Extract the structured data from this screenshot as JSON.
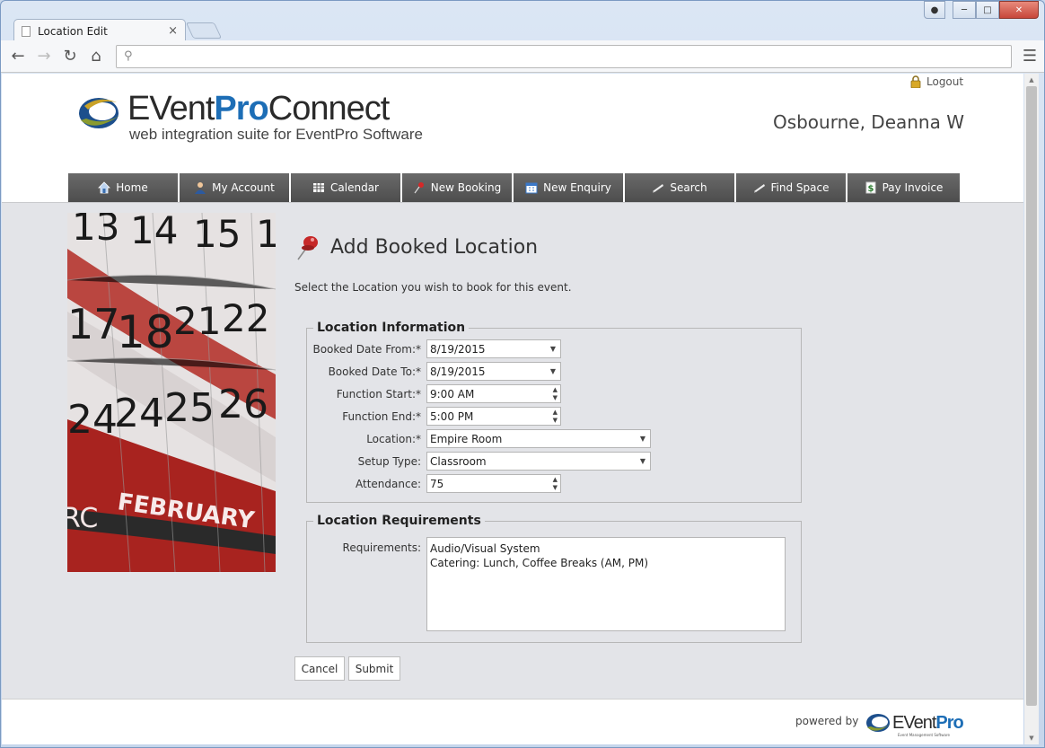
{
  "browser": {
    "tab_title": "Location Edit",
    "url": ""
  },
  "header": {
    "logo_event": "EVent",
    "logo_pro": "Pro",
    "logo_connect": "Connect",
    "logo_tagline": "web integration suite for EventPro Software",
    "logout_label": "Logout",
    "username": "Osbourne, Deanna W"
  },
  "nav": {
    "items": [
      {
        "label": "Home",
        "icon": "home-icon"
      },
      {
        "label": "My Account",
        "icon": "user-icon"
      },
      {
        "label": "Calendar",
        "icon": "calendar-grid-icon"
      },
      {
        "label": "New Booking",
        "icon": "pushpin-icon"
      },
      {
        "label": "New Enquiry",
        "icon": "calendar-icon"
      },
      {
        "label": "Search",
        "icon": "search-stylus-icon"
      },
      {
        "label": "Find Space",
        "icon": "find-space-icon"
      },
      {
        "label": "Pay Invoice",
        "icon": "dollar-icon"
      }
    ]
  },
  "photo": {
    "numbers_row1": [
      "13",
      "14",
      "15",
      "1"
    ],
    "numbers_row2": [
      "17",
      "18",
      "21",
      "22"
    ],
    "numbers_row3": [
      "24",
      "24",
      "25",
      "26"
    ],
    "month": "FEBRUARY",
    "fragment": "RC"
  },
  "form": {
    "heading": "Add Booked Location",
    "instructions": "Select the Location you wish to book for this event.",
    "location_info": {
      "legend": "Location Information",
      "fields": {
        "booked_from": {
          "label": "Booked Date From:*",
          "value": "8/19/2015"
        },
        "booked_to": {
          "label": "Booked Date To:*",
          "value": "8/19/2015"
        },
        "function_start": {
          "label": "Function Start:*",
          "value": "9:00 AM"
        },
        "function_end": {
          "label": "Function End:*",
          "value": "5:00 PM"
        },
        "location": {
          "label": "Location:*",
          "value": "Empire Room"
        },
        "setup_type": {
          "label": "Setup Type:",
          "value": "Classroom"
        },
        "attendance": {
          "label": "Attendance:",
          "value": "75"
        }
      }
    },
    "requirements": {
      "legend": "Location Requirements",
      "label": "Requirements:",
      "line1": "Audio/Visual System",
      "line2": "Catering: Lunch, Coffee Breaks (AM, PM)"
    },
    "cancel_label": "Cancel",
    "submit_label": "Submit"
  },
  "footer": {
    "powered_by": "powered by",
    "logo_event": "EVent",
    "logo_pro": "Pro",
    "logo_sub": "Event Management Software"
  },
  "colors": {
    "brand_blue": "#1d6eb6",
    "nav_bg": "#555555",
    "content_bg": "#e3e4e8"
  }
}
